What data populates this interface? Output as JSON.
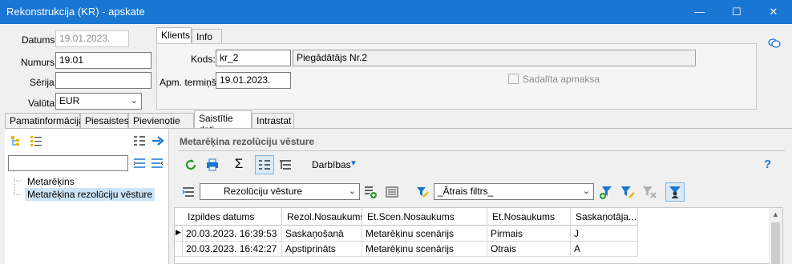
{
  "window": {
    "title": "Rekonstrukcija (KR) - apskate"
  },
  "form": {
    "datums_label": "Datums:",
    "datums_value": "19.01.2023.",
    "numurs_label": "Numurs:",
    "numurs_value": "19.01",
    "serija_label": "Sērija:",
    "serija_value": "",
    "valuta_label": "Valūta:",
    "valuta_value": "EUR"
  },
  "top_tabs": [
    "Klients",
    "Info"
  ],
  "client": {
    "kods_label": "Kods:",
    "kods_value": "kr_2",
    "kods_name": "Piegādātājs Nr.2",
    "term_label": "Apm. termiņš:",
    "term_value": "19.01.2023.",
    "split_label": "Sadalīta apmaksa"
  },
  "main_tabs": [
    "Pamatinformācija",
    "Piesaistes",
    "Pievienotie faili",
    "Saistītie dati",
    "Intrastat"
  ],
  "tree": {
    "items": [
      "Metarēķins",
      "Metarēķina rezolūciju vēsture"
    ]
  },
  "right": {
    "heading": "Metarēķina rezolūciju vēsture",
    "darbibas": "Darbības",
    "help": "?",
    "view_combo": "Rezolūciju vēsture",
    "filter_combo": "_Ātrais filtrs_"
  },
  "grid": {
    "columns": [
      "Izpildes datums",
      "Rezol.Nosaukums",
      "Et.Scen.Nosaukums",
      "Et.Nosaukums",
      "Saskaņotāja..."
    ],
    "rows": [
      [
        "20.03.2023. 16:39:53",
        "Saskaņošanā",
        "Metarēķinu scenārijs",
        "Pirmais",
        "J"
      ],
      [
        "20.03.2023. 16:42:27",
        "Apstiprināts",
        "Metarēķinu scenārijs",
        "Otrais",
        "A"
      ]
    ]
  },
  "colors": {
    "titlebar": "#1976d2",
    "selection": "#cce4f7"
  }
}
